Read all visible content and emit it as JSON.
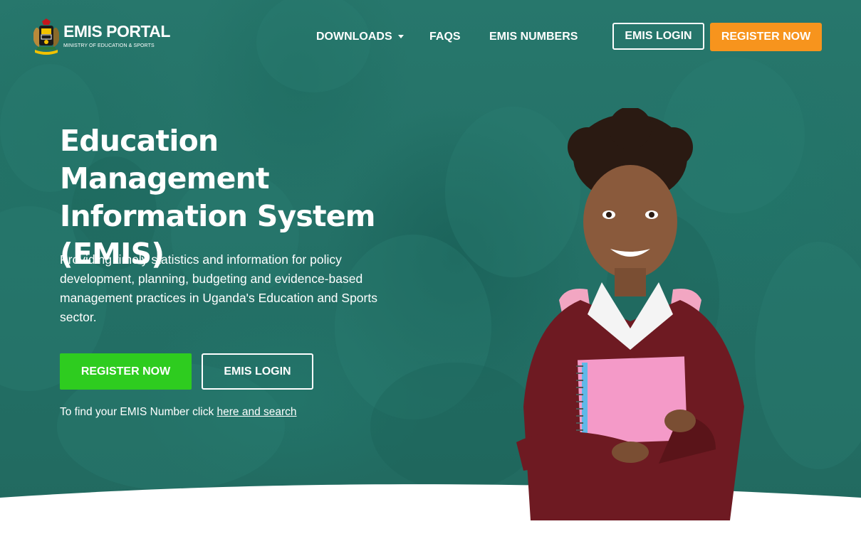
{
  "header": {
    "logo_title": "EMIS PORTAL",
    "logo_subtitle": "MINISTRY OF EDUCATION & SPORTS",
    "nav": [
      {
        "label": "DOWNLOADS",
        "icon": "chevron-down-icon"
      },
      {
        "label": "FAQS"
      },
      {
        "label": "EMIS NUMBERS"
      }
    ],
    "login_label": "EMIS LOGIN",
    "register_label": "REGISTER NOW"
  },
  "hero": {
    "title_lines": [
      "Education Management",
      "Information System",
      "(EMIS)"
    ],
    "description": "Providing timely statistics and information for policy development, planning, budgeting and evidence-based management practices in Uganda's Education and Sports sector.",
    "register_label": "REGISTER NOW",
    "login_label": "EMIS LOGIN",
    "find_text": "To find your EMIS Number click ",
    "find_link": "here and search"
  },
  "colors": {
    "hero_bg": "#237066",
    "register_top": "#f7941d",
    "register_main": "#2ecc1f",
    "text": "#ffffff"
  }
}
